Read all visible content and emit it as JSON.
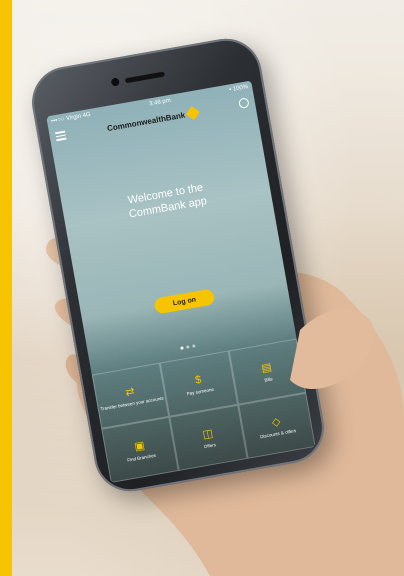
{
  "status_bar": {
    "carrier": "•••○○ Virgin 4G",
    "time": "3:46 pm",
    "battery": "• 100%"
  },
  "app": {
    "brand_name": "CommonwealthBank",
    "welcome": [
      "Welcome to the",
      "CommBank app"
    ],
    "logon_label": "Log on"
  },
  "tiles": [
    {
      "label": "Transfer between your accounts",
      "icon": "transfer-icon"
    },
    {
      "label": "Pay someone",
      "icon": "pay-icon"
    },
    {
      "label": "Bills",
      "icon": "bill-icon"
    },
    {
      "label": "Find Branches",
      "icon": "branch-icon"
    },
    {
      "label": "Offers",
      "icon": "offers-icon"
    },
    {
      "label": "Discounts & offers",
      "icon": "tag-icon"
    }
  ],
  "colors": {
    "accent": "#f6c400",
    "background": "#ebe2d6"
  }
}
